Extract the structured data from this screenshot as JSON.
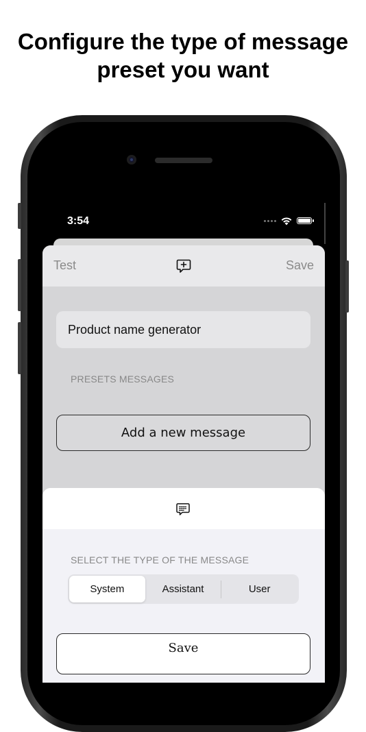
{
  "headline": "Configure the type of message preset you want",
  "status_bar": {
    "time": "3:54"
  },
  "nav": {
    "left_label": "Test",
    "right_label": "Save",
    "center_icon": "add-message-icon"
  },
  "preset_name_field": {
    "value": "Product name generator"
  },
  "presets_section_label": "PRESETS MESSAGES",
  "add_message_button": "Add a new message",
  "bottom_sheet": {
    "header_icon": "message-bubble-icon",
    "type_label": "SELECT THE TYPE OF THE MESSAGE",
    "segments": [
      "System",
      "Assistant",
      "User"
    ],
    "selected_segment": "System",
    "save_button": "Save"
  },
  "colors": {
    "sheet_bg": "#d5d5d7",
    "bottom_sheet_bg": "#f2f2f7",
    "accent_text": "#8a8a8a"
  }
}
